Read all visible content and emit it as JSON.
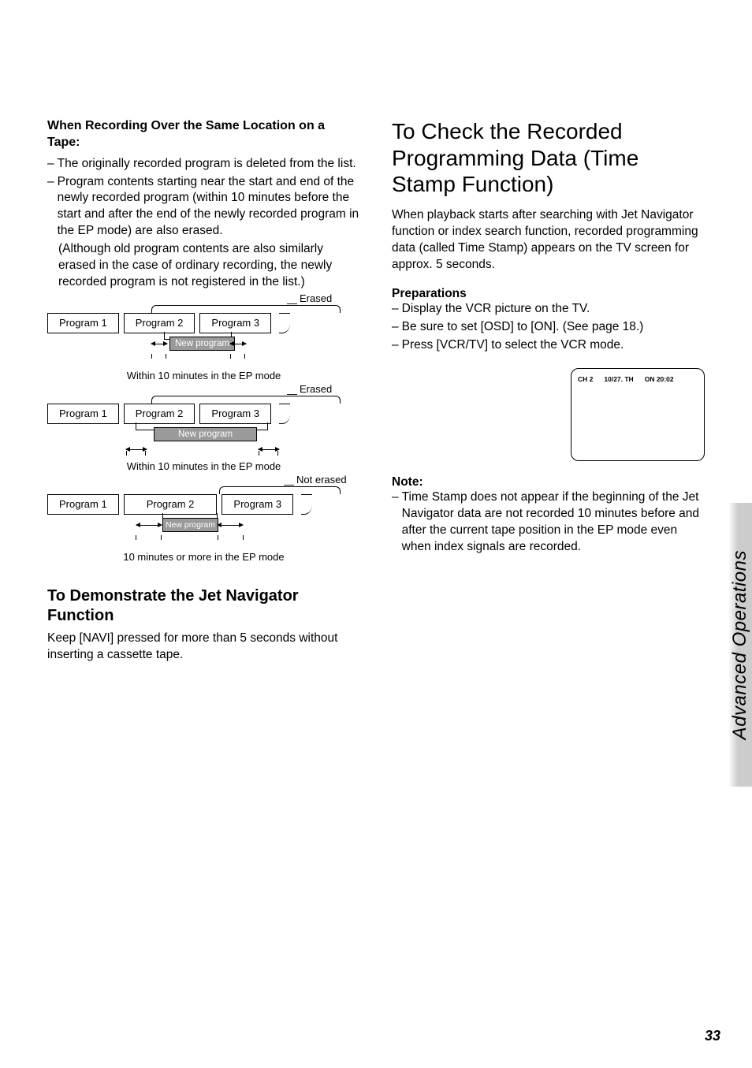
{
  "left": {
    "heading": "When Recording Over the Same Location on a Tape:",
    "item1": "The originally recorded program is deleted from the list.",
    "item2": "Program contents starting near the start and end of the newly recorded program (within 10 minutes before the start and after the end of the newly recorded program in the EP mode) are also erased.",
    "item2_paren": "(Although old program contents are also similarly erased in the case of ordinary recording, the newly recorded program is not registered in the list.)",
    "diag": {
      "erased": "Erased",
      "not_erased": "Not erased",
      "prog1": "Program 1",
      "prog2": "Program 2",
      "prog3": "Program 3",
      "newprog": "New program",
      "cap_within": "Within 10 minutes in the EP mode",
      "cap_10more": "10 minutes or more in the EP mode"
    },
    "demo_heading": "To Demonstrate the Jet Navigator Function",
    "demo_body": "Keep [NAVI] pressed for more than 5 seconds without inserting a cassette tape."
  },
  "right": {
    "title": "To Check the Recorded Programming Data (Time Stamp Function)",
    "intro": "When playback starts after searching with Jet Navigator function or index search function, recorded programming data (called Time Stamp) appears on the TV screen for approx. 5 seconds.",
    "prep_heading": "Preparations",
    "prep1": "Display the VCR picture on the TV.",
    "prep2": "Be sure to set [OSD] to [ON]. (See page 18.)",
    "prep3": "Press [VCR/TV] to select the VCR mode.",
    "tv": {
      "ch": "CH 2",
      "date": "10/27. TH",
      "on": "ON 20:02"
    },
    "note_heading": "Note:",
    "note_body": "Time Stamp does not appear if the beginning of the Jet Navigator data are not recorded 10 minutes before and after the current tape position in the EP mode even when index signals are recorded."
  },
  "side": "Advanced Operations",
  "page_number": "33"
}
